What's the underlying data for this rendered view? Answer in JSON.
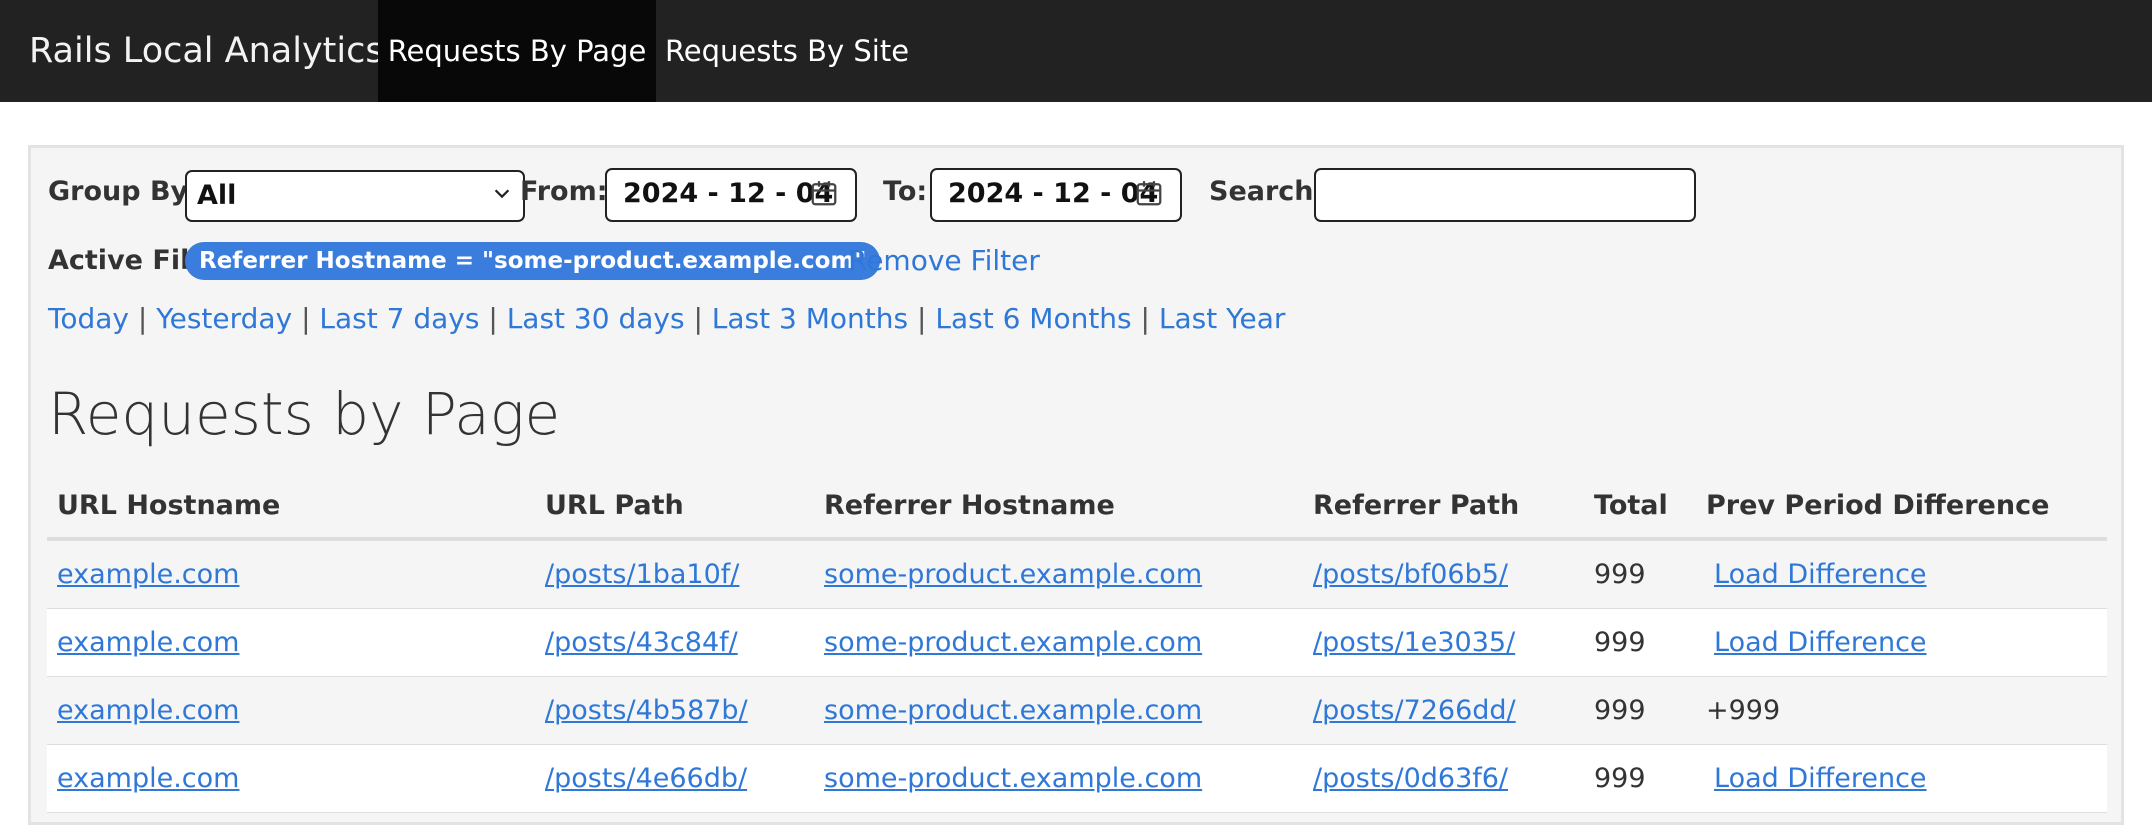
{
  "navbar": {
    "brand": "Rails Local Analytics",
    "items": [
      {
        "label": "Requests By Page",
        "active": true
      },
      {
        "label": "Requests By Site",
        "active": false
      }
    ],
    "background": "#222222"
  },
  "filters": {
    "group_by_label": "Group By:",
    "group_by_value": "All",
    "from_label": "From:",
    "from_value": "2024 - 12 - 04",
    "to_label": "To:",
    "to_value": "2024 - 12 - 04",
    "search_label": "Search:",
    "search_value": "",
    "active_filter_label": "Active Filter:",
    "active_filter_badge": "Referrer Hostname = \"some-product.example.com\"",
    "remove_filter": "Remove Filter",
    "quick_ranges": [
      "Today",
      "Yesterday",
      "Last 7 days",
      "Last 30 days",
      "Last 3 Months",
      "Last 6 Months",
      "Last Year"
    ],
    "separator": "|"
  },
  "main": {
    "title": "Requests by Page",
    "columns": [
      "URL Hostname",
      "URL Path",
      "Referrer Hostname",
      "Referrer Path",
      "Total",
      "Prev Period Difference"
    ],
    "rows": [
      {
        "url_hostname": "example.com",
        "url_path": "/posts/1ba10f/",
        "referrer_hostname": "some-product.example.com",
        "referrer_path": "/posts/bf06b5/",
        "total": "999",
        "diff": "Load Difference",
        "diff_is_link": true
      },
      {
        "url_hostname": "example.com",
        "url_path": "/posts/43c84f/",
        "referrer_hostname": "some-product.example.com",
        "referrer_path": "/posts/1e3035/",
        "total": "999",
        "diff": "Load Difference",
        "diff_is_link": true
      },
      {
        "url_hostname": "example.com",
        "url_path": "/posts/4b587b/",
        "referrer_hostname": "some-product.example.com",
        "referrer_path": "/posts/7266dd/",
        "total": "999",
        "diff": "+999",
        "diff_is_link": false
      },
      {
        "url_hostname": "example.com",
        "url_path": "/posts/4e66db/",
        "referrer_hostname": "some-product.example.com",
        "referrer_path": "/posts/0d63f6/",
        "total": "999",
        "diff": "Load Difference",
        "diff_is_link": true
      }
    ]
  },
  "colors": {
    "link": "#2f78d8",
    "badge": "#3b7ddd",
    "panel": "#f5f5f5"
  },
  "icons": {
    "select": "chevron-down-icon",
    "date": "calendar-icon"
  }
}
